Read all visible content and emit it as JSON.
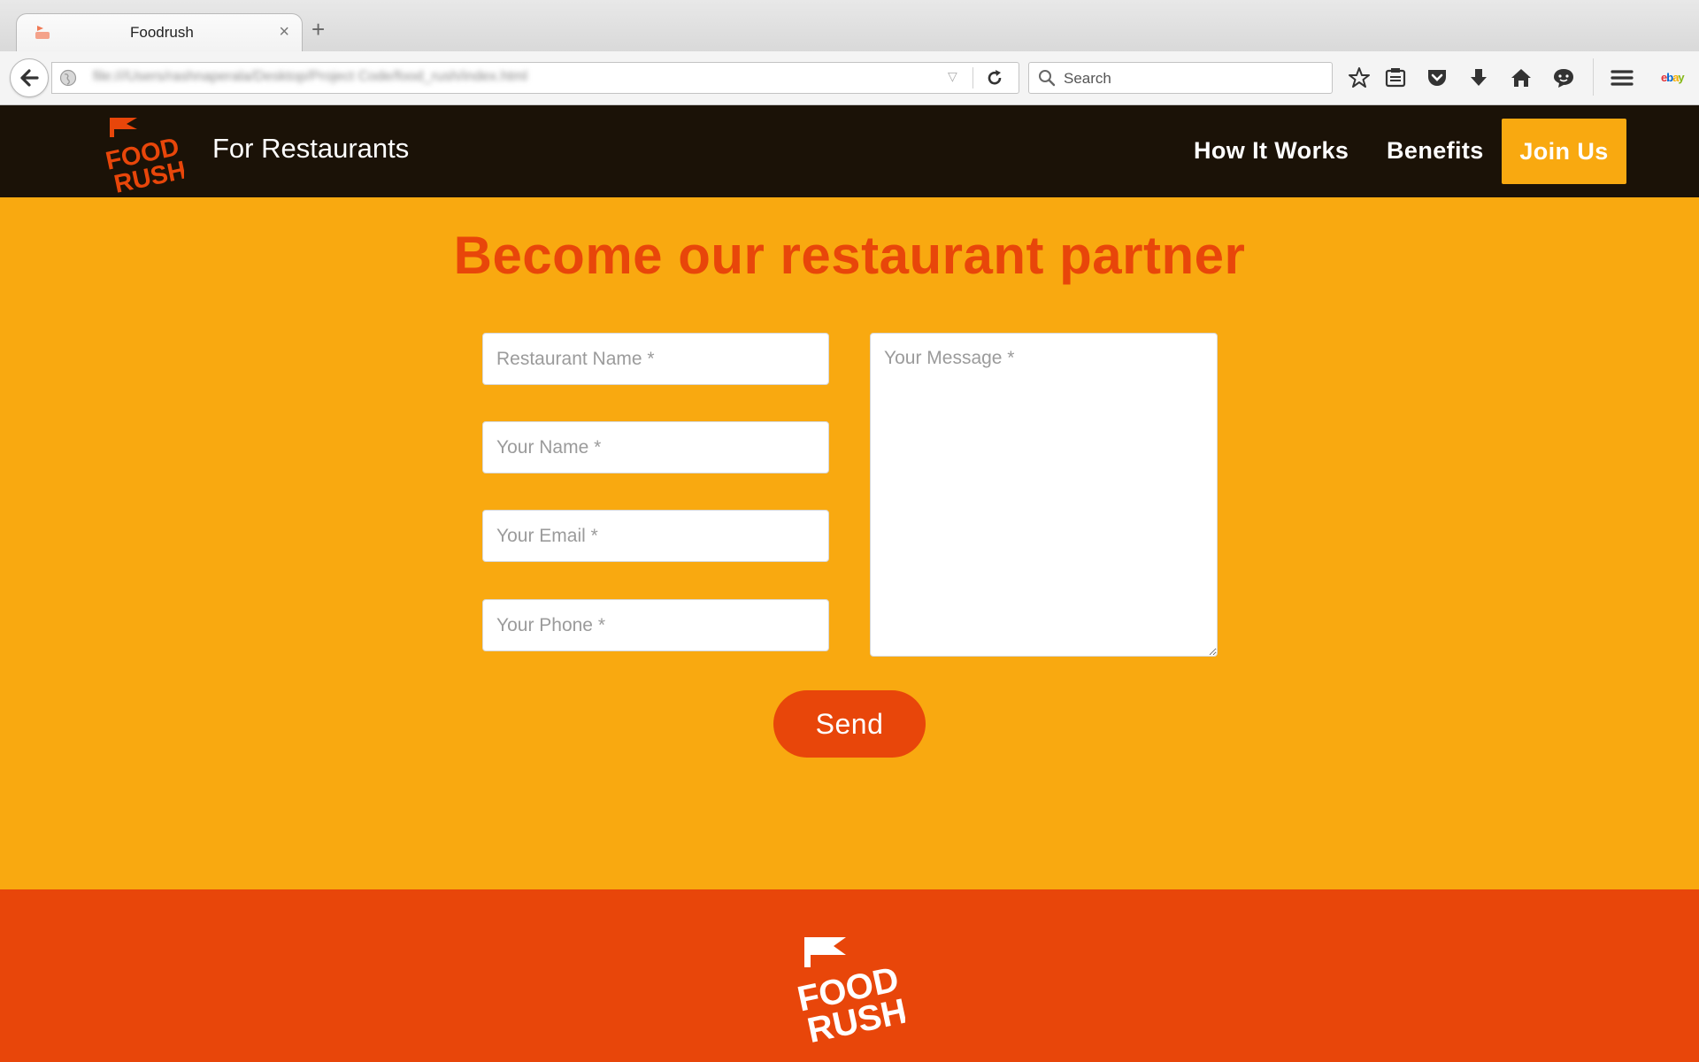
{
  "browser": {
    "tab_title": "Foodrush",
    "tab_close": "×",
    "new_tab": "+",
    "url": "file:///Users/rashnaperala/Desktop/Project Code/food_rush/index.html",
    "search_placeholder": "Search",
    "ebay_label": "ebay"
  },
  "header": {
    "logo_line1": "FOOD",
    "logo_line2": "RUSH",
    "section_title": "For Restaurants",
    "nav": {
      "how_it_works": "How It Works",
      "benefits": "Benefits",
      "join_us": "Join Us"
    }
  },
  "form": {
    "heading": "Become our restaurant partner",
    "restaurant_name_placeholder": "Restaurant Name *",
    "your_name_placeholder": "Your Name *",
    "your_email_placeholder": "Your Email *",
    "your_phone_placeholder": "Your Phone *",
    "message_placeholder": "Your Message *",
    "send_label": "Send"
  },
  "footer": {
    "logo_line1": "FOOD",
    "logo_line2": "RUSH"
  },
  "colors": {
    "brand_orange": "#e8460a",
    "brand_yellow": "#f9a910",
    "header_dark": "#1b1207"
  }
}
